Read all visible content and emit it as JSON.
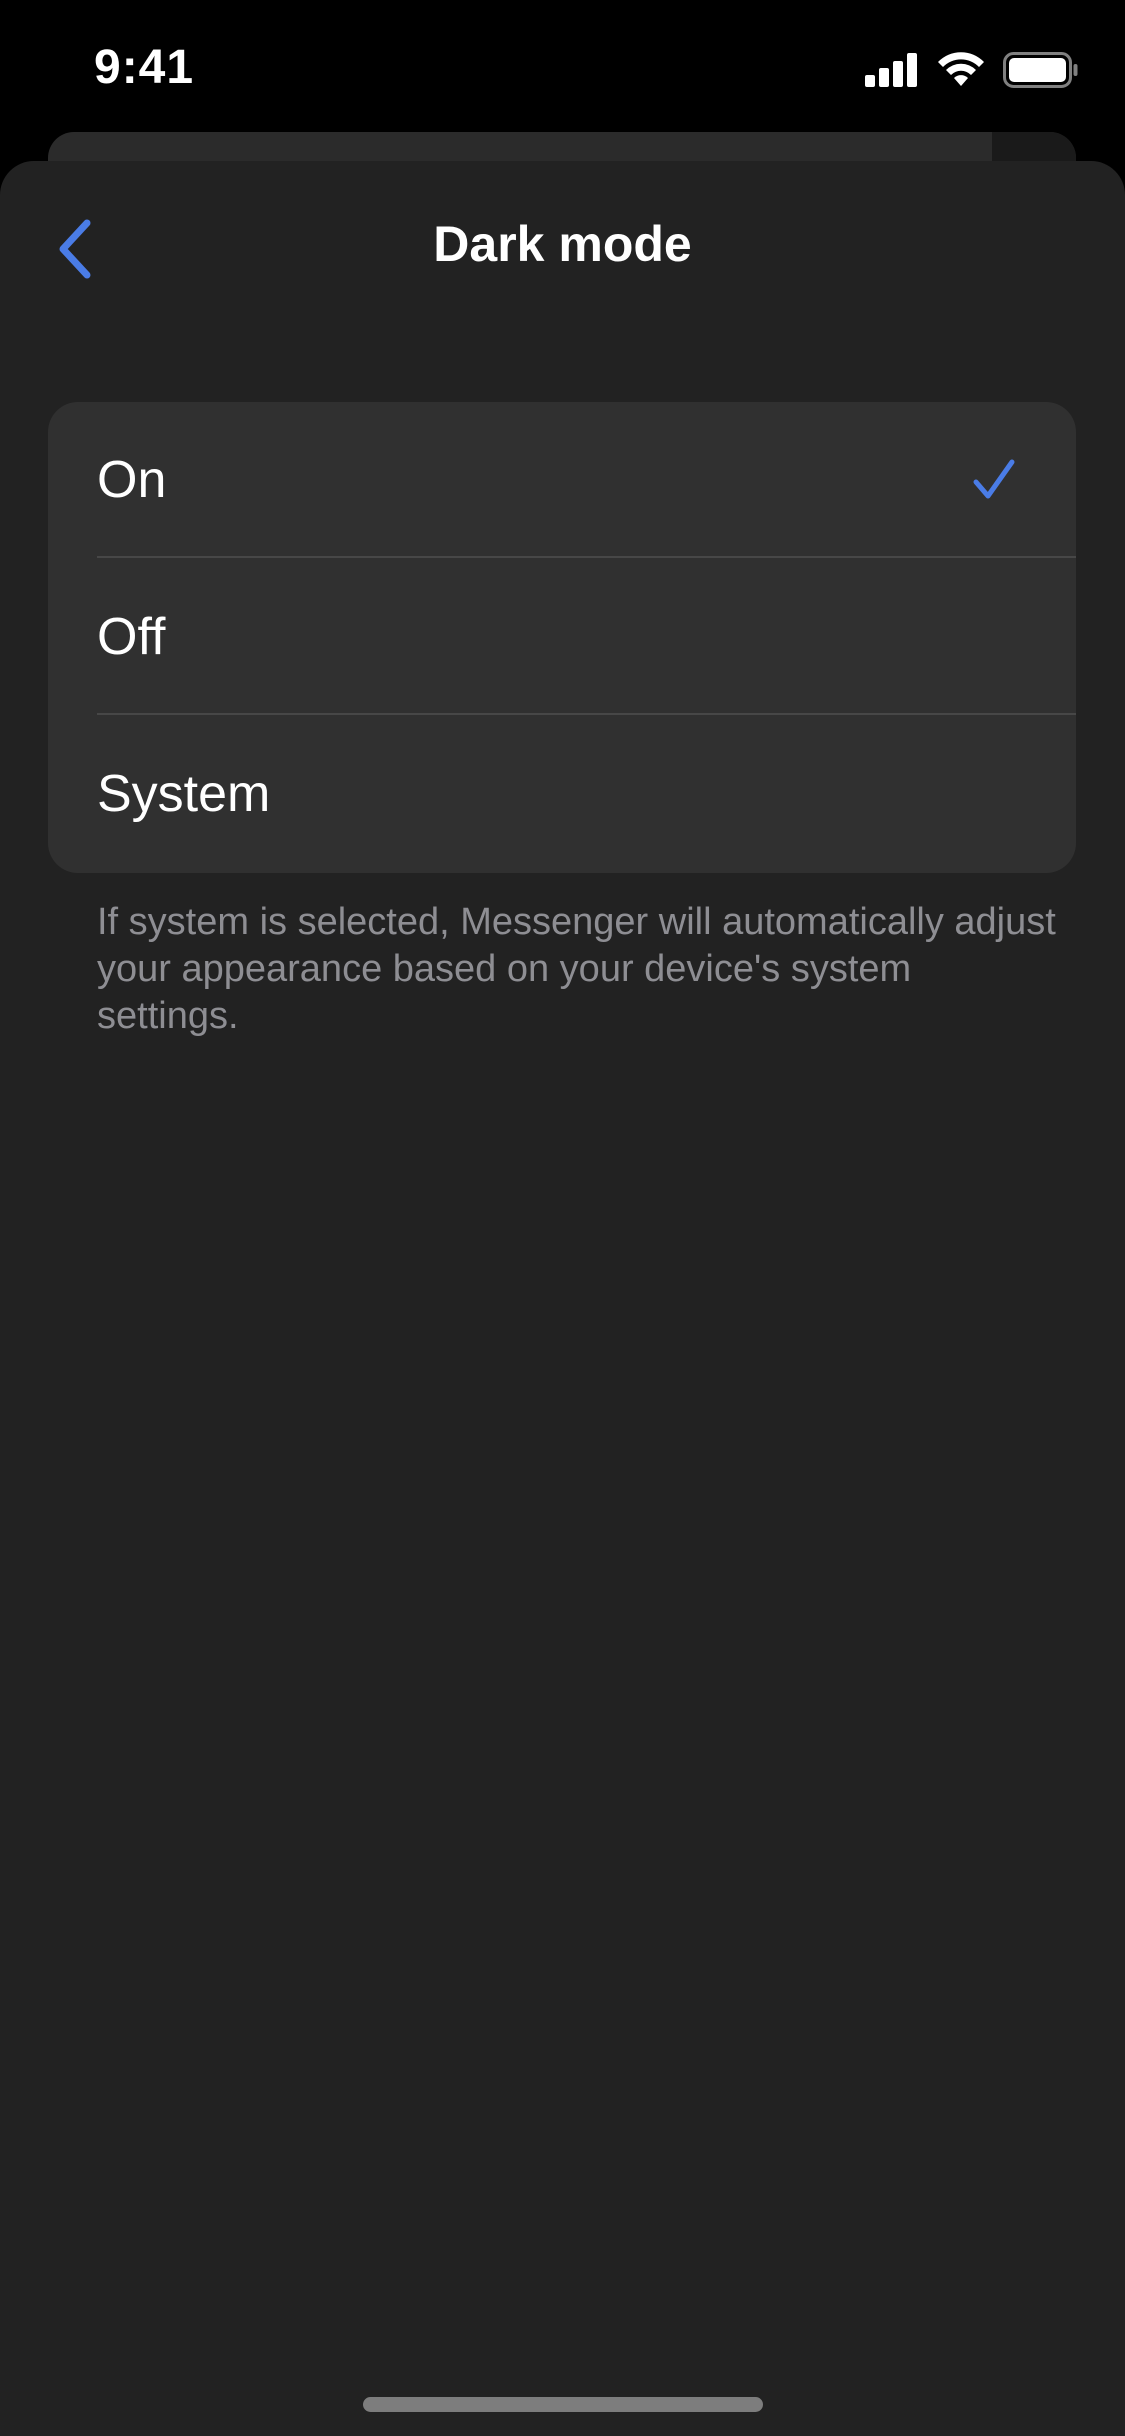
{
  "status_bar": {
    "time": "9:41",
    "icons": [
      "cellular-signal-icon",
      "wifi-icon",
      "battery-icon"
    ]
  },
  "header": {
    "title": "Dark mode",
    "back_icon": "chevron-left-icon"
  },
  "options": [
    {
      "label": "On",
      "selected": true
    },
    {
      "label": "Off",
      "selected": false
    },
    {
      "label": "System",
      "selected": false
    }
  ],
  "helper_text": "If system is selected, Messenger will automatically adjust your appearance based on your device's system settings.",
  "colors": {
    "accent": "#4a7ce6",
    "sheet_background": "#222222",
    "card_background": "#303030",
    "secondary_text": "#8e8e93"
  }
}
